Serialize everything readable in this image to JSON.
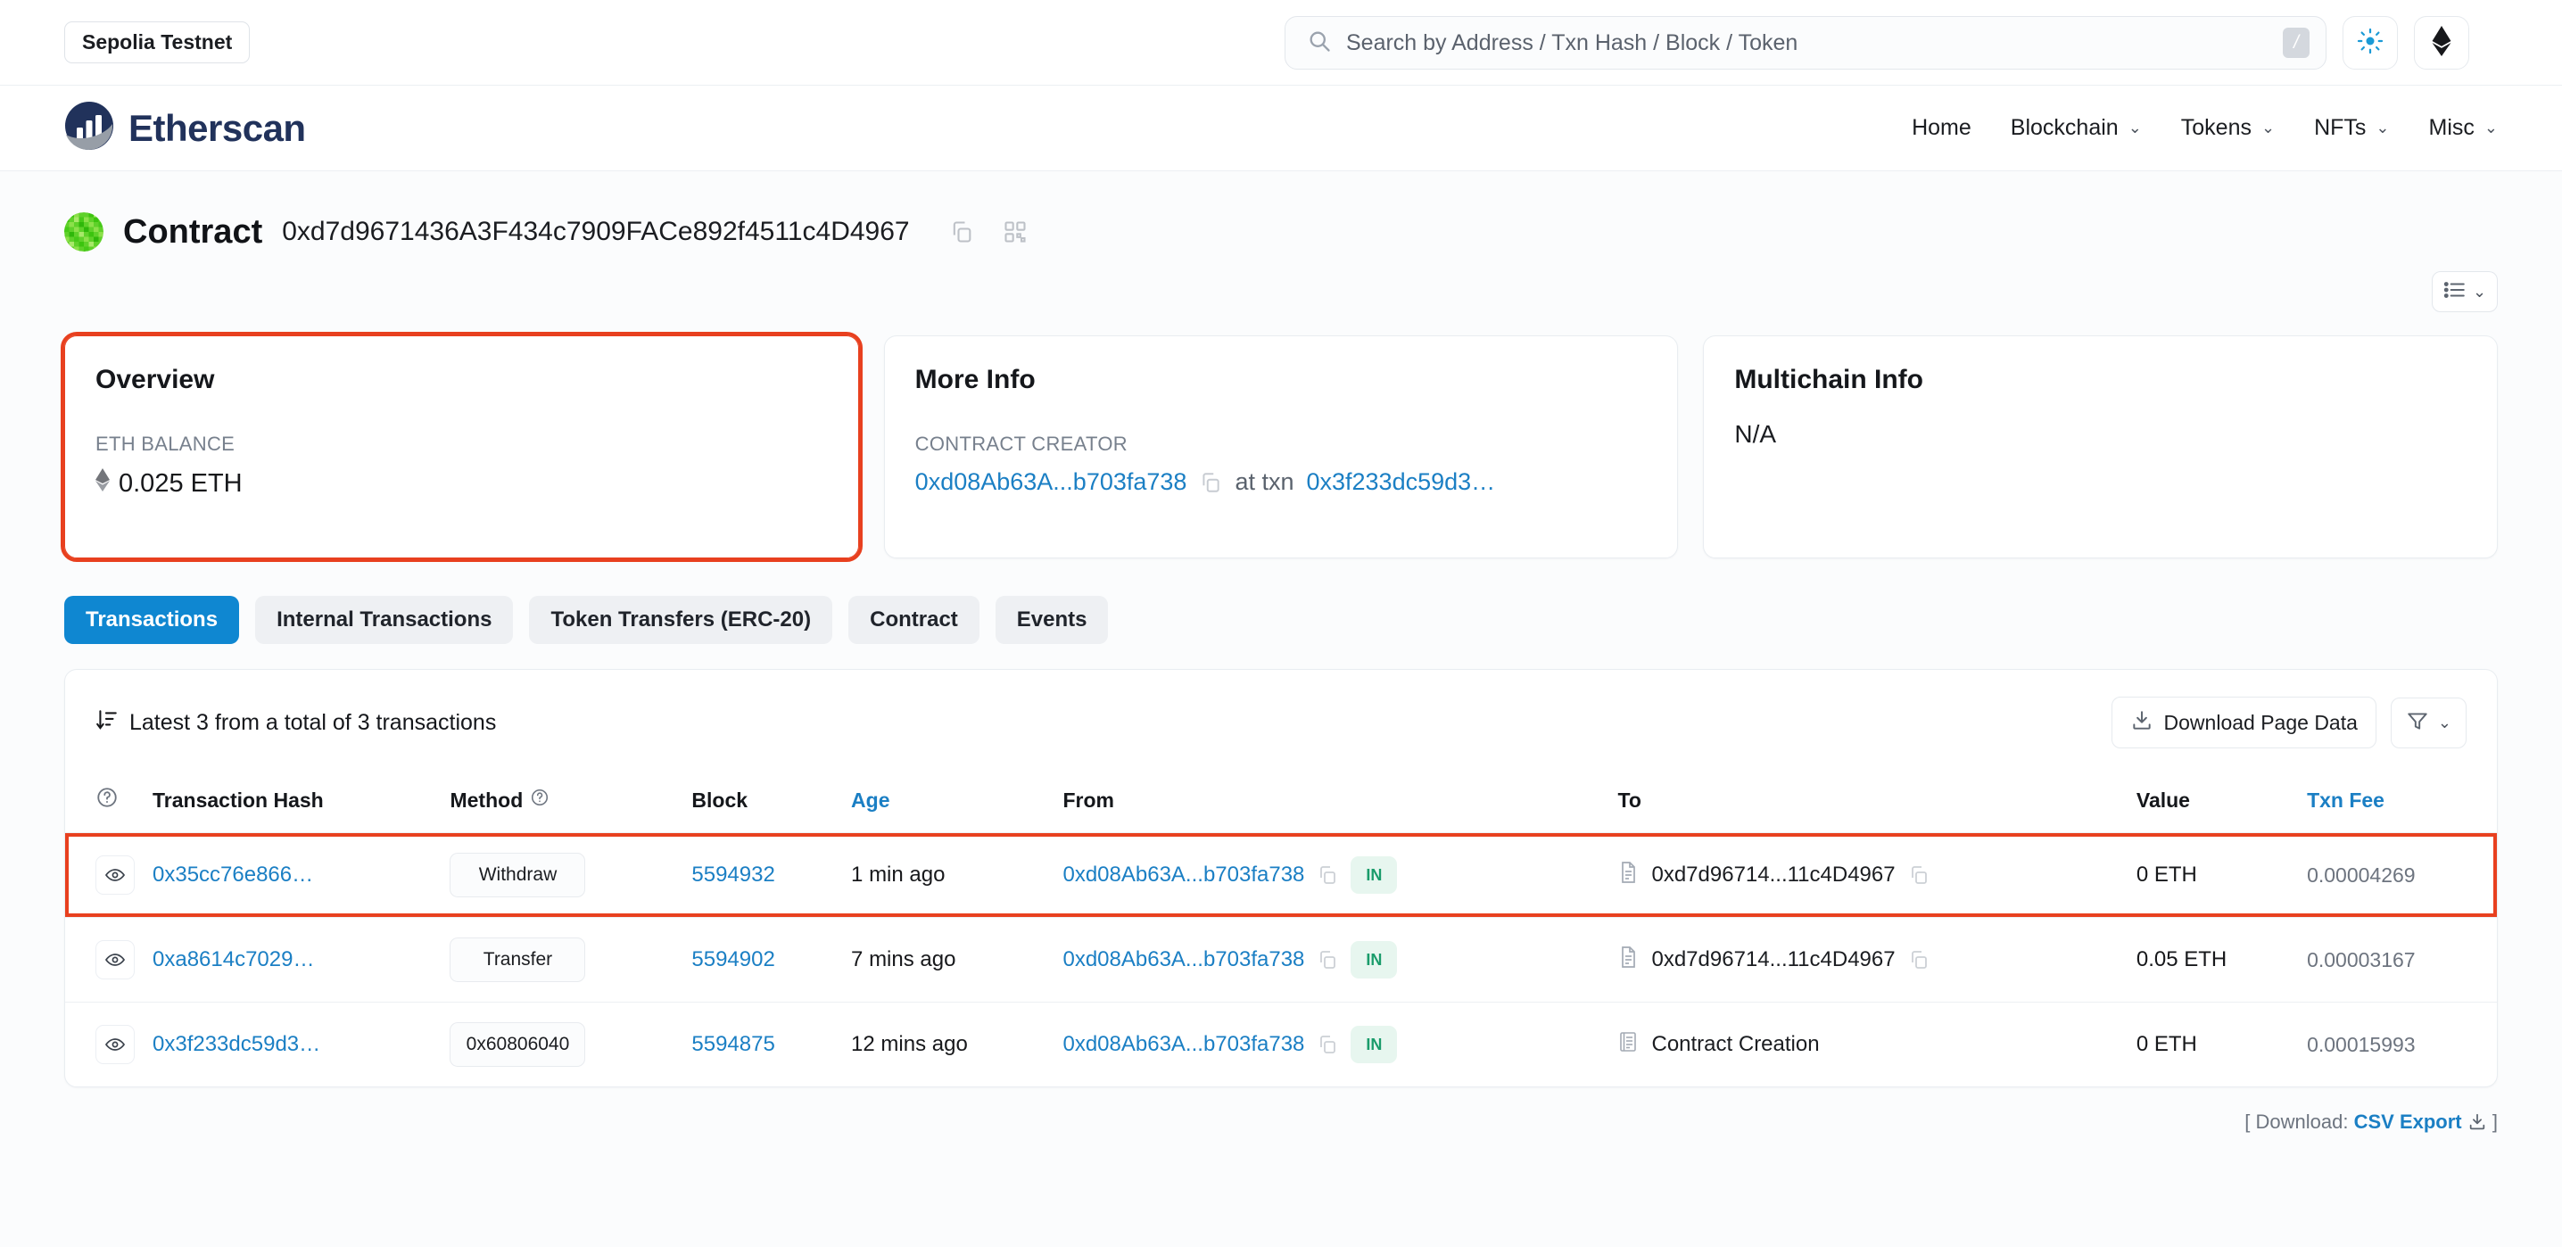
{
  "topbar": {
    "network_label": "Sepolia Testnet",
    "search": {
      "placeholder": "Search by Address / Txn Hash / Block / Token",
      "value": "",
      "shortcut_key": "/"
    },
    "theme_toggle_icon": "sun-icon",
    "chain_icon": "ethereum-diamond-icon"
  },
  "nav": {
    "brand": "Etherscan",
    "items": [
      {
        "label": "Home",
        "has_dropdown": false
      },
      {
        "label": "Blockchain",
        "has_dropdown": true
      },
      {
        "label": "Tokens",
        "has_dropdown": true
      },
      {
        "label": "NFTs",
        "has_dropdown": true
      },
      {
        "label": "Misc",
        "has_dropdown": true
      }
    ]
  },
  "page_header": {
    "title": "Contract",
    "address": "0xd7d9671436A3F434c7909FACe892f4511c4D4967",
    "copy_icon": "copy-icon",
    "qr_icon": "qr-code-icon"
  },
  "cards": {
    "overview": {
      "title": "Overview",
      "balance_label": "ETH BALANCE",
      "balance_value": "0.025 ETH",
      "highlighted": true,
      "highlight_color": "#e8401f"
    },
    "more_info": {
      "title": "More Info",
      "creator_label": "CONTRACT CREATOR",
      "creator_address": "0xd08Ab63A...b703fa738",
      "at_txn_label": "at txn",
      "creation_txn": "0x3f233dc59d3…"
    },
    "multichain": {
      "title": "Multichain Info",
      "value": "N/A"
    }
  },
  "tabs": [
    {
      "label": "Transactions",
      "active": true
    },
    {
      "label": "Internal Transactions",
      "active": false
    },
    {
      "label": "Token Transfers (ERC-20)",
      "active": false
    },
    {
      "label": "Contract",
      "active": false
    },
    {
      "label": "Events",
      "active": false
    }
  ],
  "table_panel": {
    "summary": "Latest 3 from a total of 3 transactions",
    "download_button": "Download Page Data",
    "filter_icon": "funnel-icon",
    "columns": [
      "",
      "Transaction Hash",
      "Method",
      "Block",
      "Age",
      "From",
      "To",
      "Value",
      "Txn Fee"
    ],
    "rows": [
      {
        "hash": "0x35cc76e866…",
        "method": "Withdraw",
        "block": "5594932",
        "age": "1 min ago",
        "from": "0xd08Ab63A...b703fa738",
        "direction": "IN",
        "to": "0xd7d96714...11c4D4967",
        "to_is_contract": true,
        "value": "0 ETH",
        "fee": "0.00004269",
        "highlighted": true
      },
      {
        "hash": "0xa8614c7029…",
        "method": "Transfer",
        "block": "5594902",
        "age": "7 mins ago",
        "from": "0xd08Ab63A...b703fa738",
        "direction": "IN",
        "to": "0xd7d96714...11c4D4967",
        "to_is_contract": true,
        "value": "0.05 ETH",
        "fee": "0.00003167",
        "highlighted": false
      },
      {
        "hash": "0x3f233dc59d3…",
        "method": "0x60806040",
        "block": "5594875",
        "age": "12 mins ago",
        "from": "0xd08Ab63A...b703fa738",
        "direction": "IN",
        "to": "Contract Creation",
        "to_is_contract": false,
        "value": "0 ETH",
        "fee": "0.00015993",
        "highlighted": false
      }
    ]
  },
  "footer": {
    "prefix": "[ Download:",
    "link": "CSV Export",
    "suffix": "]"
  },
  "colors": {
    "link_blue": "#1b7fc4",
    "tab_active": "#0f87d1",
    "highlight_red": "#e8401f",
    "in_badge_green": "#1a9c6b"
  }
}
